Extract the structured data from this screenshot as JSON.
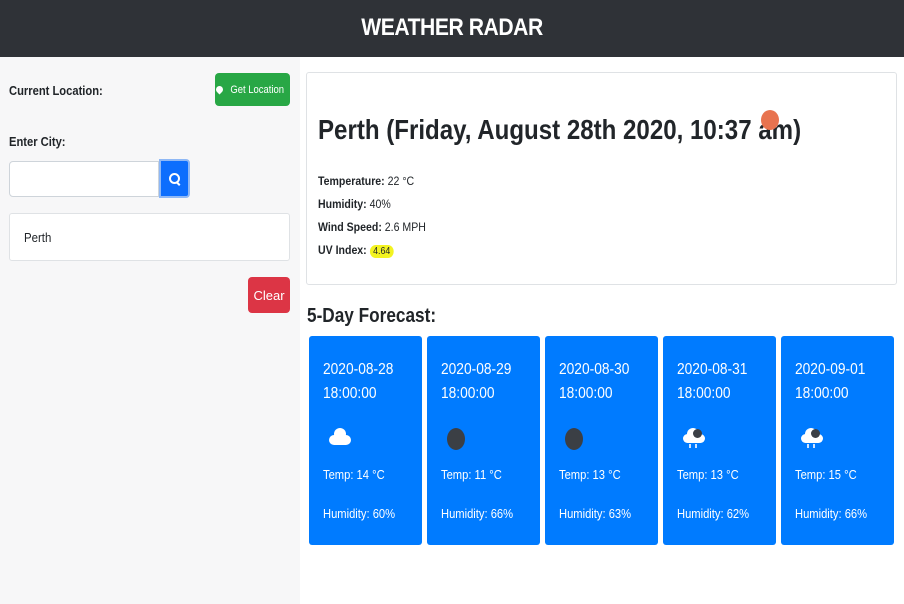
{
  "header": {
    "title": "WEATHER RADAR"
  },
  "sidebar": {
    "current_location_label": "Current Location:",
    "get_location_label": "Get Location",
    "enter_city_label": "Enter City:",
    "city_input_value": "",
    "history": [
      "Perth"
    ],
    "clear_label": "Clear"
  },
  "current": {
    "title": "Perth (Friday, August 28th 2020, 10:37 am)",
    "temperature_label": "Temperature:",
    "temperature_value": "22 °C",
    "humidity_label": "Humidity:",
    "humidity_value": "40%",
    "wind_label": "Wind Speed:",
    "wind_value": "2.6 MPH",
    "uv_label": "UV Index:",
    "uv_value": "4.64",
    "icon": "sun-icon",
    "colors": {
      "sun": "#e8734f",
      "uv_badge": "#f3f321"
    }
  },
  "forecast": {
    "title": "5-Day Forecast:",
    "days": [
      {
        "date": "2020-08-28",
        "time": "18:00:00",
        "icon": "cloud-icon",
        "temp": "Temp: 14 °C",
        "humidity": "Humidity: 60%"
      },
      {
        "date": "2020-08-29",
        "time": "18:00:00",
        "icon": "moon-icon",
        "temp": "Temp: 11 °C",
        "humidity": "Humidity: 66%"
      },
      {
        "date": "2020-08-30",
        "time": "18:00:00",
        "icon": "moon-icon",
        "temp": "Temp: 13 °C",
        "humidity": "Humidity: 63%"
      },
      {
        "date": "2020-08-31",
        "time": "18:00:00",
        "icon": "rain-icon",
        "temp": "Temp: 13 °C",
        "humidity": "Humidity: 62%"
      },
      {
        "date": "2020-09-01",
        "time": "18:00:00",
        "icon": "rain-icon",
        "temp": "Temp: 15 °C",
        "humidity": "Humidity: 66%"
      }
    ]
  },
  "colors": {
    "header_bg": "#2f3237",
    "card_blue": "#007bff",
    "green": "#28a745",
    "red": "#dc3545"
  }
}
